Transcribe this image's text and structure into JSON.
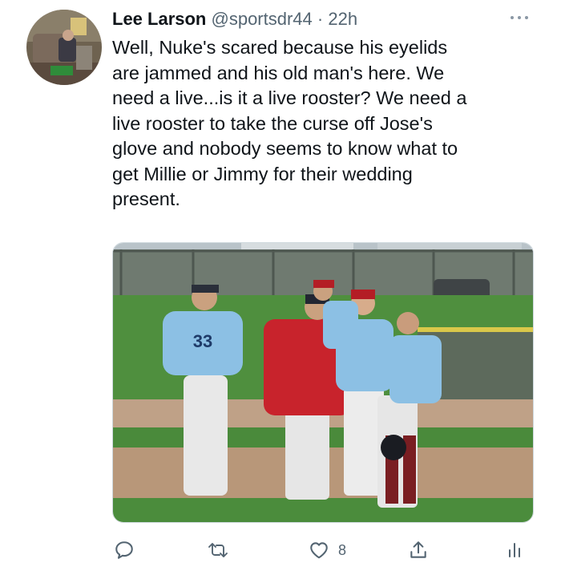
{
  "tweet": {
    "author_name": "Lee Larson",
    "author_handle": "@sportsdr44",
    "separator": "·",
    "time_ago": "22h",
    "text": "Well, Nuke's scared because his eyelids\nare jammed and his old man's here. We\nneed a live...is it a live rooster? We need a\nlive rooster to take the curse off Jose's\nglove and nobody seems to know what to\nget Millie or Jimmy for their wedding\npresent.",
    "jersey_number": "33"
  },
  "actions": {
    "reply": {
      "icon": "reply-icon"
    },
    "retweet": {
      "icon": "retweet-icon"
    },
    "like": {
      "icon": "heart-icon",
      "count": "8"
    },
    "share": {
      "icon": "share-icon"
    },
    "analytics": {
      "icon": "analytics-icon"
    }
  },
  "colors": {
    "text": "#0f1419",
    "secondary": "#536471",
    "border": "#cfd9de"
  }
}
